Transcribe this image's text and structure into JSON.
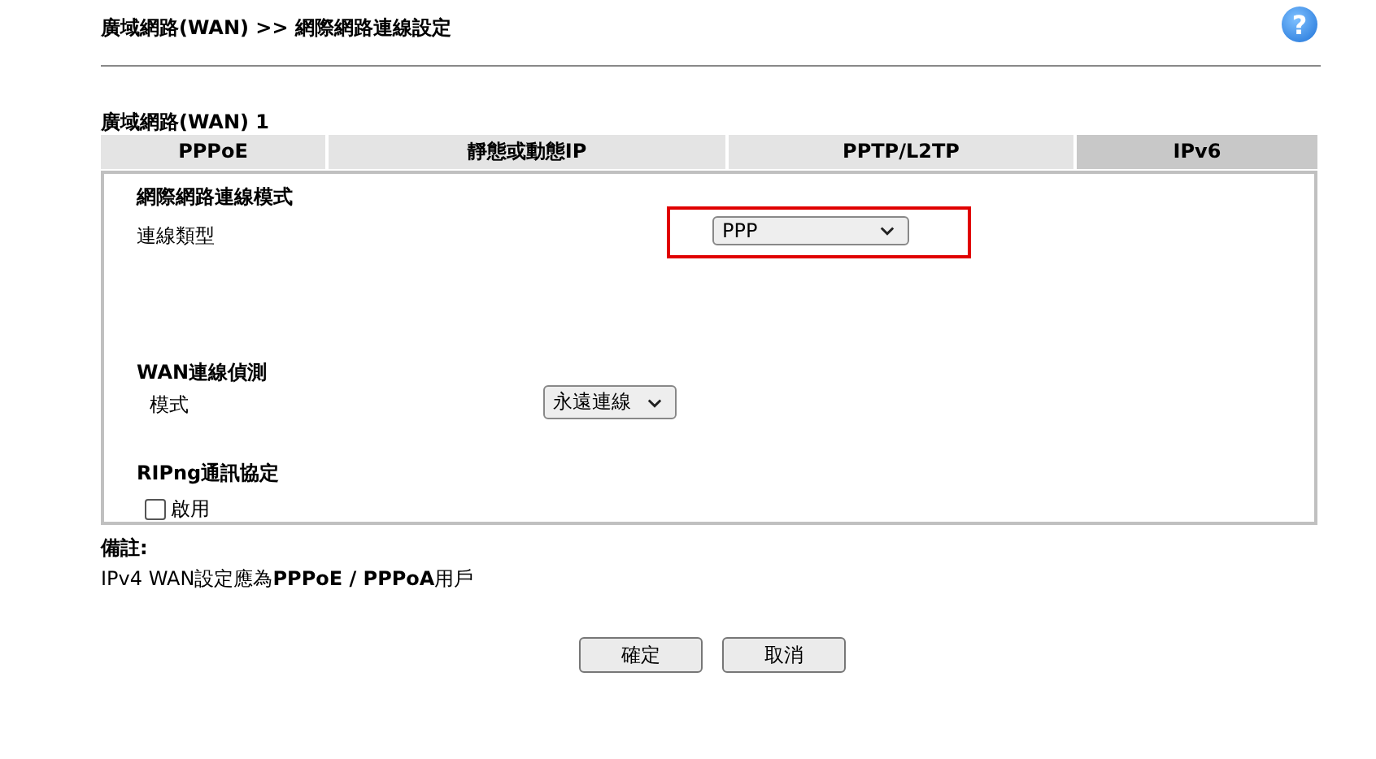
{
  "header": {
    "breadcrumb": "廣域網路(WAN) >> 網際網路連線設定",
    "help_icon": "?"
  },
  "section_title": "廣域網路(WAN) 1",
  "tabs": [
    {
      "label": "PPPoE",
      "selected": false
    },
    {
      "label": "靜態或動態IP",
      "selected": false
    },
    {
      "label": "PPTP/L2TP",
      "selected": false
    },
    {
      "label": "IPv6",
      "selected": true
    }
  ],
  "panel": {
    "groups": [
      {
        "title": "網際網路連線模式",
        "rows": [
          {
            "kind": "select",
            "label": "連線類型",
            "value": "PPP",
            "highlighted": true
          }
        ]
      },
      {
        "title": "WAN連線偵測",
        "rows": [
          {
            "kind": "select",
            "label": "模式",
            "value": "永遠連線",
            "highlighted": false
          }
        ]
      },
      {
        "title": "RIPng通訊協定",
        "rows": [
          {
            "kind": "checkbox",
            "label": "啟用",
            "checked": false
          }
        ]
      }
    ]
  },
  "note": {
    "title": "備註:",
    "text": "IPv4 WAN設定應為**PPPoE / PPPoA**用戶"
  },
  "buttons": [
    "確定",
    "取消"
  ]
}
